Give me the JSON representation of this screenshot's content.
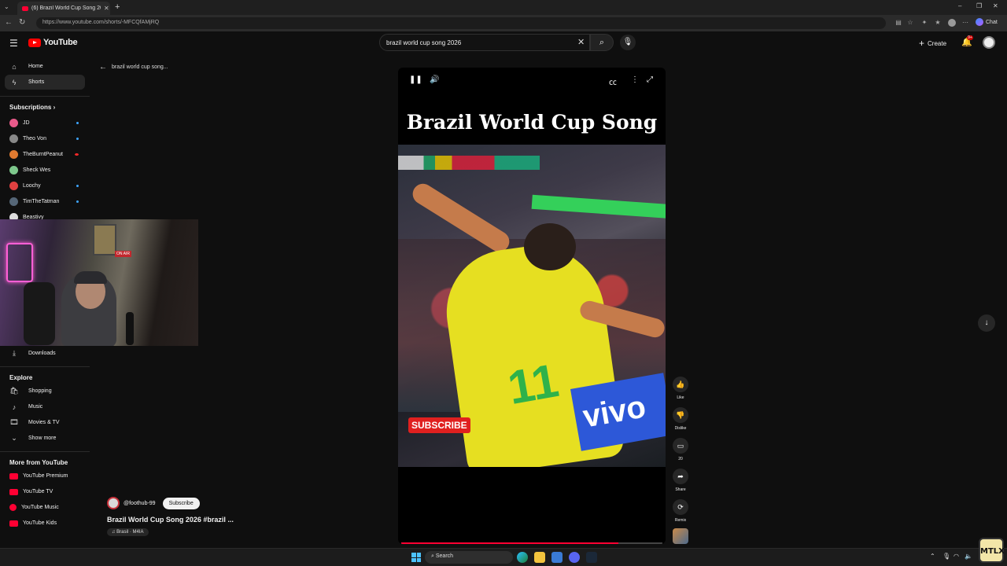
{
  "browser": {
    "tab_title": "(6) Brazil World Cup Song 2026",
    "url": "https://www.youtube.com/shorts/-MFCQfAMjRQ",
    "chat_label": "Chat"
  },
  "header": {
    "logo_text": "YouTube",
    "search_query": "brazil world cup song 2026",
    "create_label": "Create",
    "notification_count": "9+"
  },
  "sidebar": {
    "items": [
      {
        "label": "Home",
        "icon": "home-icon"
      },
      {
        "label": "Shorts",
        "icon": "shorts-icon"
      }
    ],
    "subscriptions_heading": "Subscriptions",
    "subscriptions": [
      {
        "label": "JD",
        "color": "#e85a8a"
      },
      {
        "label": "Theo Von",
        "color": "#888888"
      },
      {
        "label": "TheBurntPeanut",
        "color": "#e07a30"
      },
      {
        "label": "Sheck Wes",
        "color": "#7ec88c"
      },
      {
        "label": "Loochy",
        "color": "#e04040"
      },
      {
        "label": "TimTheTatman",
        "color": "#556677"
      },
      {
        "label": "Beastivy",
        "color": "#dddddd"
      }
    ],
    "downloads_label": "Downloads",
    "explore_heading": "Explore",
    "explore": [
      {
        "label": "Shopping",
        "icon": "shopping-bag-icon"
      },
      {
        "label": "Music",
        "icon": "music-note-icon"
      },
      {
        "label": "Movies & TV",
        "icon": "film-icon"
      },
      {
        "label": "Show more",
        "icon": "chevron-down-icon"
      }
    ],
    "more_heading": "More from YouTube",
    "more": [
      {
        "label": "YouTube Premium"
      },
      {
        "label": "YouTube TV"
      },
      {
        "label": "YouTube Music"
      },
      {
        "label": "YouTube Kids"
      }
    ]
  },
  "shorts": {
    "back_label": "brazil world cup song...",
    "overlay_title": "Brazil World Cup Song",
    "subscribe_overlay": "SUBSCRIBE",
    "jersey_number": "11",
    "sponsor_text": "vivo",
    "progress_fraction": 0.83,
    "channel_handle": "@foothub-99",
    "subscribe_label": "Subscribe",
    "video_title": "Brazil World Cup Song 2026 #brazil ...",
    "music_label": "Brasil · M4IA",
    "actions": {
      "like": "Like",
      "dislike": "Dislike",
      "comments": "20",
      "share": "Share",
      "remix": "Remix"
    }
  },
  "taskbar": {
    "search_placeholder": "Search"
  },
  "corner_logo_text": "MTLX",
  "colors": {
    "accent_red": "#ff0033",
    "link_blue": "#3ea6ff"
  }
}
